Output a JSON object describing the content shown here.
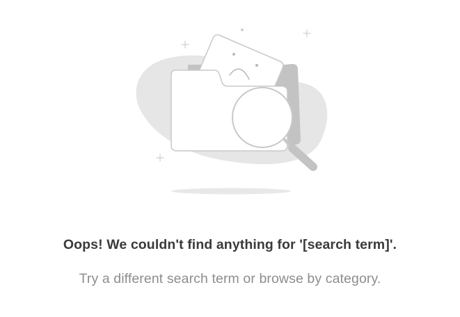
{
  "empty_state": {
    "illustration_icon": "folder-search-not-found-icon",
    "heading": "Oops! We couldn't find anything for '[search term]'.",
    "subtext": "Try a different search term or browse by category."
  }
}
